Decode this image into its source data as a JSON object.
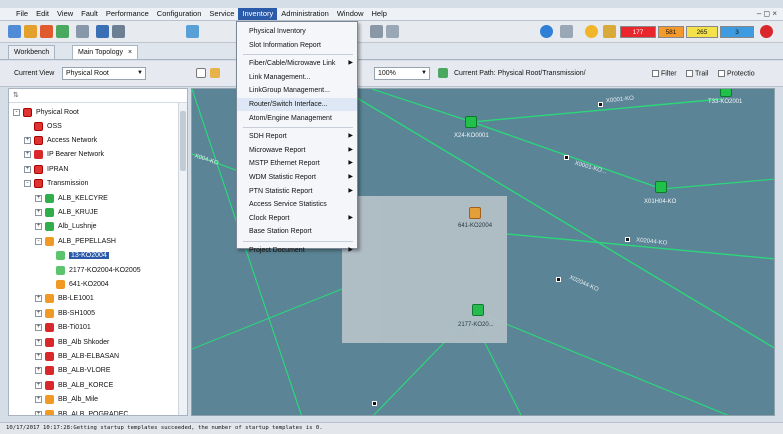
{
  "menubar": {
    "items": [
      "File",
      "Edit",
      "View",
      "Fault",
      "Performance",
      "Configuration",
      "Service",
      "Inventory",
      "Administration",
      "Window",
      "Help"
    ],
    "active_index": 7,
    "window_controls": "– ◻ ×"
  },
  "toolbar": {
    "alarms": [
      {
        "value": "177",
        "color": "#e8262b"
      },
      {
        "value": "581",
        "color": "#f59a2a"
      },
      {
        "value": "265",
        "color": "#f4e24a"
      },
      {
        "value": "3",
        "color": "#3f9be0"
      }
    ]
  },
  "tabs": [
    {
      "label": "Workbench"
    },
    {
      "label": "Main Topology",
      "close": "×"
    }
  ],
  "options": {
    "current_view_label": "Current View",
    "current_view_value": "Physical Root",
    "zoom_value": "100%",
    "current_path": "Current Path: Physical Root/Transmission/",
    "filter_label": "Filter",
    "trail_label": "Trail",
    "protection_label": "Protectio"
  },
  "tree": {
    "header": "",
    "root": "Physical Root",
    "items": [
      {
        "label": "OSS",
        "depth": 1,
        "icon": "redsq",
        "expander": ""
      },
      {
        "label": "Access Network",
        "depth": 1,
        "icon": "redsq",
        "expander": "+"
      },
      {
        "label": "IP Bearer Network",
        "depth": 1,
        "icon": "red",
        "expander": "+"
      },
      {
        "label": "IPRAN",
        "depth": 1,
        "icon": "redsq",
        "expander": "+"
      },
      {
        "label": "Transmission",
        "depth": 1,
        "icon": "redsq",
        "expander": "-"
      },
      {
        "label": "ALB_KELCYRE",
        "depth": 2,
        "icon": "green",
        "expander": "+"
      },
      {
        "label": "ALB_KRUJE",
        "depth": 2,
        "icon": "green",
        "expander": "+"
      },
      {
        "label": "Alb_Lushnje",
        "depth": 2,
        "icon": "green",
        "expander": "+"
      },
      {
        "label": "ALB_PEPELLASH",
        "depth": 2,
        "icon": "orange",
        "expander": "-"
      },
      {
        "label": "13-KO2004",
        "depth": 3,
        "icon": "ltgreen",
        "expander": "",
        "selected": true
      },
      {
        "label": "2177-KO2004-KO2005",
        "depth": 3,
        "icon": "ltgreen",
        "expander": ""
      },
      {
        "label": "641-KO2004",
        "depth": 3,
        "icon": "orange",
        "expander": ""
      },
      {
        "label": "BB-LE1001",
        "depth": 2,
        "icon": "orange",
        "expander": "+"
      },
      {
        "label": "BB-SH1005",
        "depth": 2,
        "icon": "orange",
        "expander": "+"
      },
      {
        "label": "BB-Ti0101",
        "depth": 2,
        "icon": "red",
        "expander": "+"
      },
      {
        "label": "BB_Alb Shkoder",
        "depth": 2,
        "icon": "red",
        "expander": "+"
      },
      {
        "label": "BB_ALB-ELBASAN",
        "depth": 2,
        "icon": "red",
        "expander": "+"
      },
      {
        "label": "BB_ALB-VLORE",
        "depth": 2,
        "icon": "red",
        "expander": "+"
      },
      {
        "label": "BB_ALB_KORCE",
        "depth": 2,
        "icon": "red",
        "expander": "+"
      },
      {
        "label": "BB_Alb_Mile",
        "depth": 2,
        "icon": "orange",
        "expander": "+"
      },
      {
        "label": "BB_ALB_POGRADEC",
        "depth": 2,
        "icon": "orange",
        "expander": "+"
      }
    ]
  },
  "inventory_menu": {
    "items": [
      {
        "label": "Physical Inventory",
        "sub": false
      },
      {
        "label": "Slot Information Report",
        "sub": false
      },
      {
        "sep": true
      },
      {
        "label": "Fiber/Cable/Microwave Link",
        "sub": true
      },
      {
        "label": "Link Management...",
        "sub": false
      },
      {
        "label": "LinkGroup Management...",
        "sub": false
      },
      {
        "label": "Router/Switch Interface...",
        "sub": false,
        "hover": true
      },
      {
        "label": "Atom/Engine Management",
        "sub": false
      },
      {
        "sep": true
      },
      {
        "label": "SDH Report",
        "sub": true
      },
      {
        "label": "Microwave Report",
        "sub": true
      },
      {
        "label": "MSTP Ethernet Report",
        "sub": true
      },
      {
        "label": "WDM Statistic Report",
        "sub": true
      },
      {
        "label": "PTN Statistic Report",
        "sub": true
      },
      {
        "label": "Access Service Statistics",
        "sub": false
      },
      {
        "label": "Clock Report",
        "sub": true
      },
      {
        "label": "Base Station Report",
        "sub": false
      },
      {
        "sep": true
      },
      {
        "label": "Project Document",
        "sub": true
      }
    ]
  },
  "topology": {
    "nodes": [
      {
        "label": "X24-KO0001",
        "color": "green"
      },
      {
        "label": "T33-KO2001",
        "color": "green"
      },
      {
        "label": "X01H04-KO",
        "color": "green"
      },
      {
        "label": "641-KO2004",
        "color": "orange"
      },
      {
        "label": "2177-KO20...",
        "color": "green"
      }
    ],
    "link_labels": [
      "X0001-KO",
      "X0001-KO...",
      "X004-KO",
      "X02044-KO",
      "X02044-KO"
    ]
  },
  "status": {
    "message": "10/17/2017 10:17:28:Getting startup templates succeeded, the number of startup templates is 0."
  }
}
